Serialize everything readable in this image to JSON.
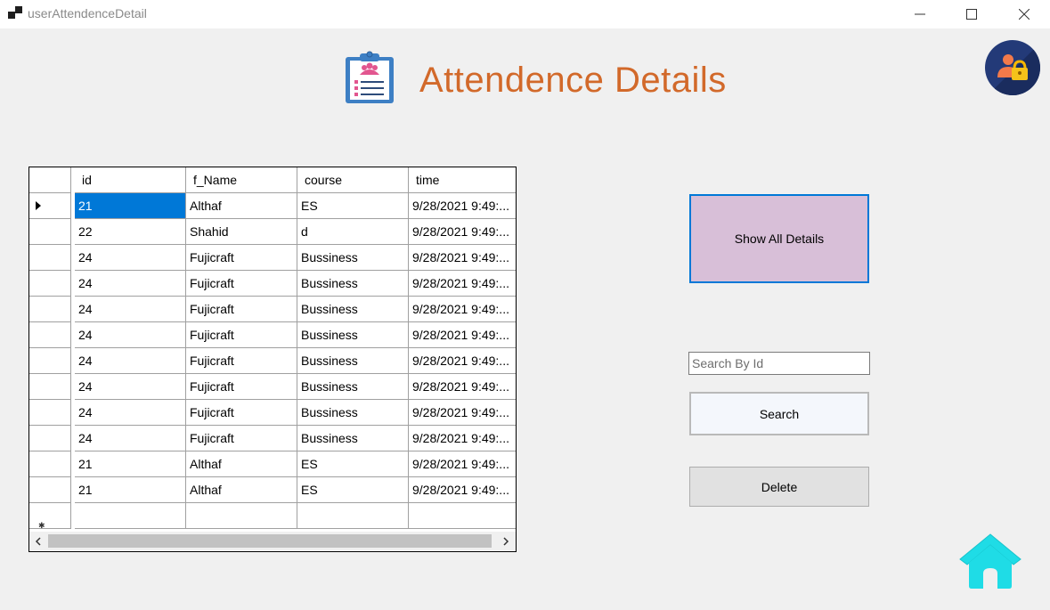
{
  "window": {
    "title": "userAttendenceDetail"
  },
  "header": {
    "title": "Attendence Details"
  },
  "grid": {
    "columns": [
      "id",
      "f_Name",
      "course",
      "time"
    ],
    "rows": [
      [
        "21",
        "Althaf",
        "ES",
        "9/28/2021 9:49:..."
      ],
      [
        "22",
        "Shahid",
        "d",
        "9/28/2021 9:49:..."
      ],
      [
        "24",
        "Fujicraft",
        "Bussiness",
        "9/28/2021 9:49:..."
      ],
      [
        "24",
        "Fujicraft",
        "Bussiness",
        "9/28/2021 9:49:..."
      ],
      [
        "24",
        "Fujicraft",
        "Bussiness",
        "9/28/2021 9:49:..."
      ],
      [
        "24",
        "Fujicraft",
        "Bussiness",
        "9/28/2021 9:49:..."
      ],
      [
        "24",
        "Fujicraft",
        "Bussiness",
        "9/28/2021 9:49:..."
      ],
      [
        "24",
        "Fujicraft",
        "Bussiness",
        "9/28/2021 9:49:..."
      ],
      [
        "24",
        "Fujicraft",
        "Bussiness",
        "9/28/2021 9:49:..."
      ],
      [
        "24",
        "Fujicraft",
        "Bussiness",
        "9/28/2021 9:49:..."
      ],
      [
        "21",
        "Althaf",
        "ES",
        "9/28/2021 9:49:..."
      ],
      [
        "21",
        "Althaf",
        "ES",
        "9/28/2021 9:49:..."
      ]
    ]
  },
  "actions": {
    "show_all_label": "Show All Details",
    "search_placeholder": "Search By Id",
    "search_value": "",
    "search_label": "Search",
    "delete_label": "Delete"
  },
  "icons": {
    "app": "app-icon",
    "header": "clipboard-icon",
    "user": "user-lock-icon",
    "home": "home-icon"
  },
  "colors": {
    "title": "#d2692a",
    "selection": "#0078d7",
    "show_all_bg": "#d8bfd8",
    "home": "#1fdce6",
    "avatar_bg": "#233a78"
  }
}
